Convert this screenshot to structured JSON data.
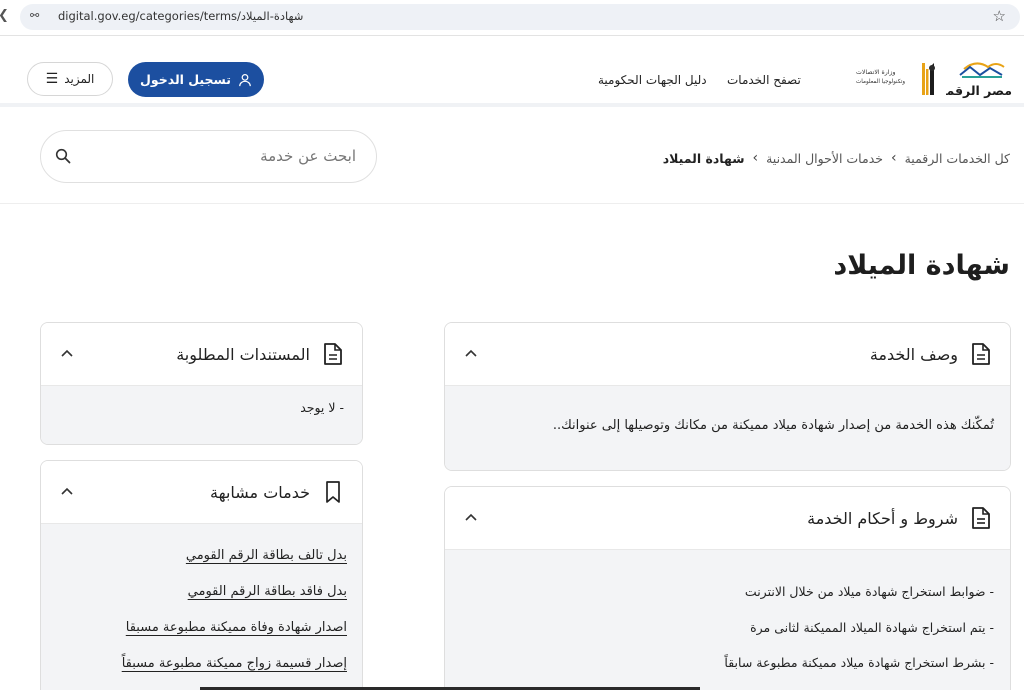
{
  "browser": {
    "url": "digital.gov.eg/categories/terms/شهادة-الميلاد"
  },
  "header": {
    "more_label": "المزيد",
    "login_label": "تسجيل الدخول",
    "nav": {
      "browse_services": "تصفح الخدمات",
      "gov_directory": "دليل الجهات الحكومية"
    },
    "logo_misr_text": "مصر الرقمية",
    "logo_ministry_text": "وزارة الاتصالات وتكنولوجيا المعلومات"
  },
  "breadcrumb": {
    "items": [
      "كل الخدمات الرقمية",
      "خدمات الأحوال المدنية"
    ],
    "current": "شهادة الميلاد"
  },
  "search": {
    "placeholder": "ابحث عن خدمة"
  },
  "page": {
    "title": "شهادة الميلاد"
  },
  "description_card": {
    "title": "وصف الخدمة",
    "text": "تُمكّنك هذه الخدمة من إصدار شهادة ميلاد مميكنة من مكانك وتوصيلها إلى عنوانك.."
  },
  "terms_card": {
    "title": "شروط و أحكام الخدمة",
    "items": [
      "- ضوابط استخراج شهادة ميلاد من خلال الانترنت",
      "- يتم استخراج شهادة الميلاد المميكنة لثانى مرة",
      "- بشرط استخراج شهادة ميلاد مميكنة مطبوعة سابقاً"
    ]
  },
  "documents_card": {
    "title": "المستندات المطلوبة",
    "text": "- لا يوجد"
  },
  "related_card": {
    "title": "خدمات مشابهة",
    "links": [
      "بدل تالف بطاقة الرقم القومي",
      "بدل فاقد بطاقة الرقم القومي",
      "اصدار شهادة وفاة مميكنة مطبوعة مسبقا",
      "إصدار قسيمة زواج مميكنة مطبوعة مسبقاً"
    ]
  },
  "colors": {
    "primary": "#1c4fa0",
    "card_body": "#f3f4f6",
    "border": "#dedede"
  },
  "icons": [
    "back-arrow-icon",
    "site-settings-icon",
    "bookmark-star-icon",
    "hamburger-menu-icon",
    "user-icon",
    "search-icon",
    "document-icon",
    "bookmark-icon",
    "chevron-up-icon",
    "chevron-left-icon"
  ]
}
